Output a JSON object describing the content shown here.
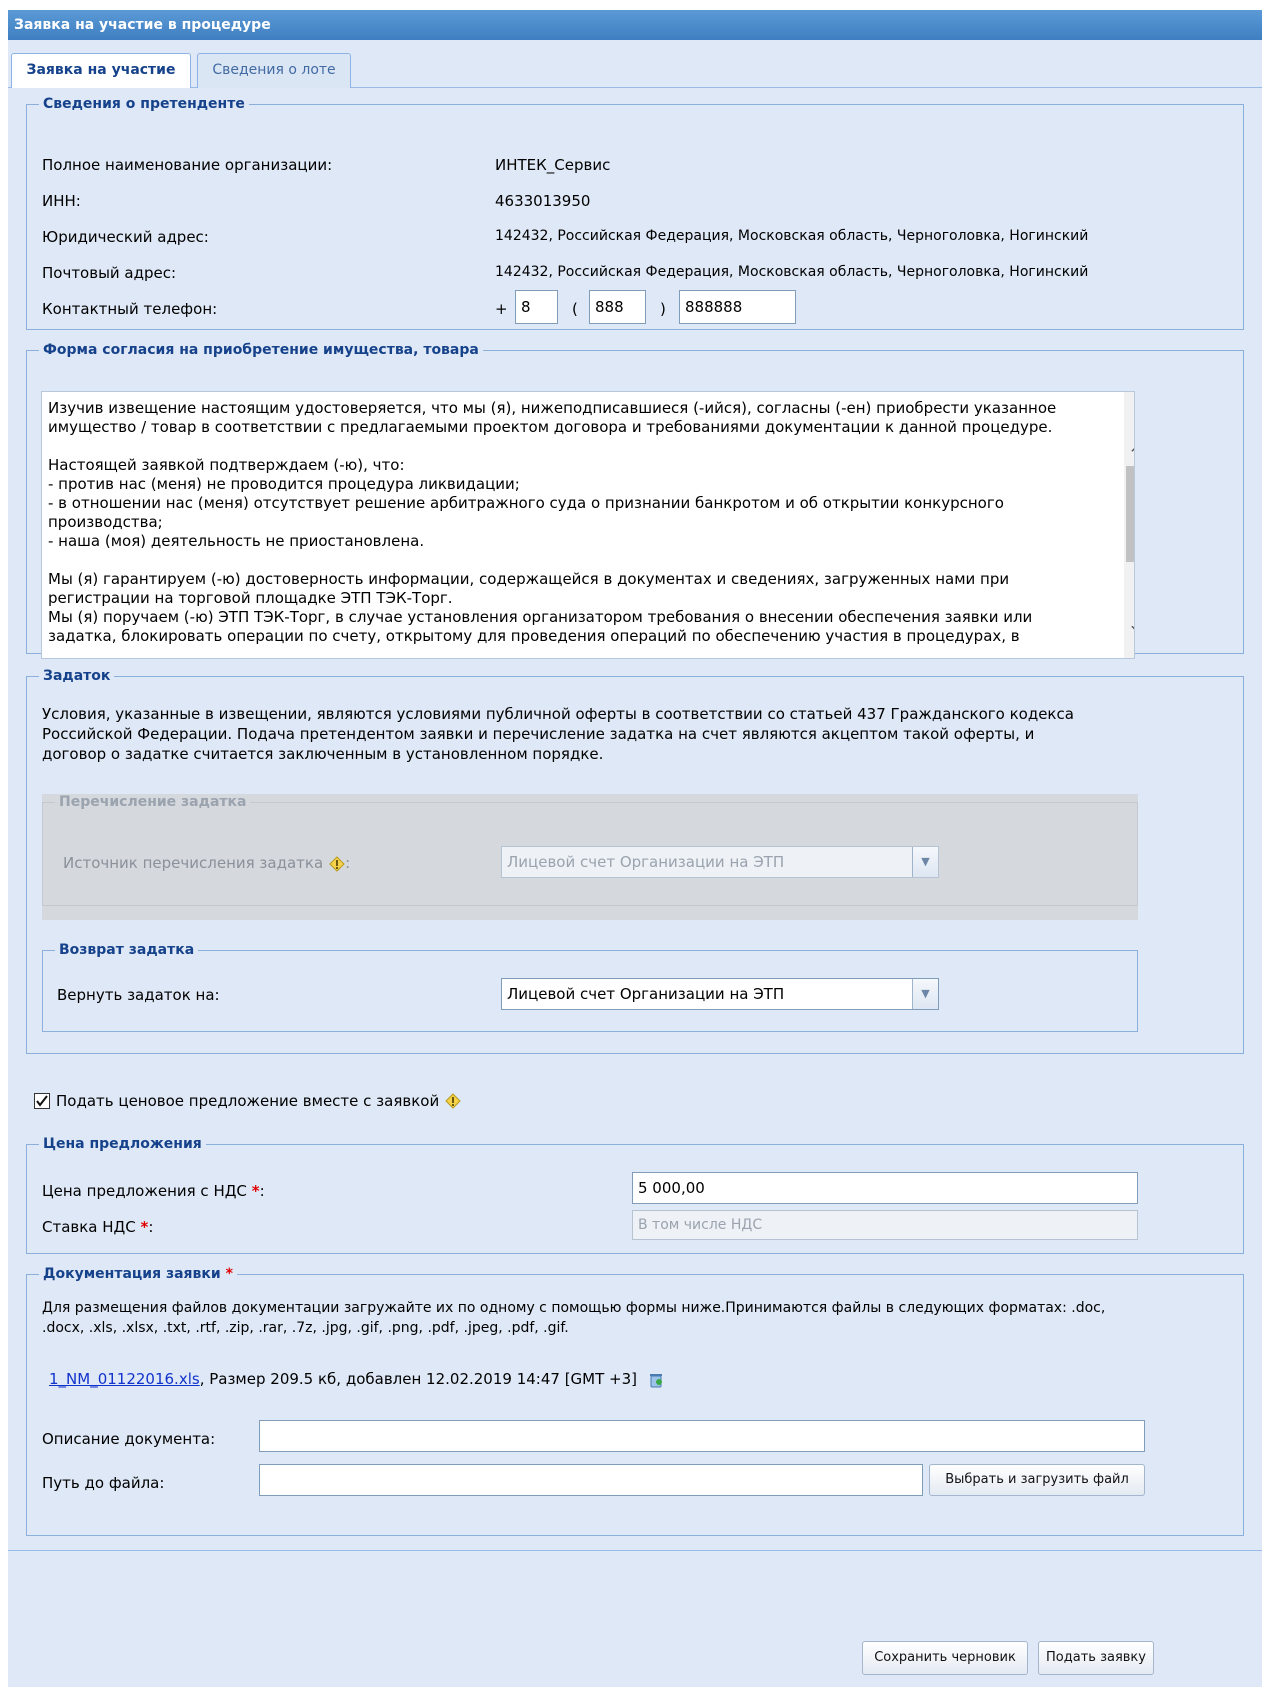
{
  "window": {
    "title": "Заявка на участие в процедуре"
  },
  "tabs": [
    {
      "label": "Заявка на участие",
      "active": true
    },
    {
      "label": "Сведения о лоте",
      "active": false
    }
  ],
  "applicant": {
    "legend": "Сведения о претенденте",
    "org_label": "Полное наименование организации:",
    "org_value": "ИНТЕК_Сервис",
    "inn_label": "ИНН:",
    "inn_value": "4633013950",
    "legal_address_label": "Юридический адрес:",
    "legal_address_value": "142432, Российская Федерация, Московская область, Черноголовка, Ногинский",
    "postal_address_label": "Почтовый адрес:",
    "postal_address_value": "142432, Российская Федерация, Московская область, Черноголовка, Ногинский",
    "phone_label": "Контактный телефон:",
    "phone_plus": "+",
    "phone_open": "(",
    "phone_close": ")",
    "phone_country": "8",
    "phone_code": "888",
    "phone_number": "888888"
  },
  "agreement": {
    "legend": "Форма согласия на приобретение имущества, товара",
    "p1": "Изучив извещение настоящим удостоверяется, что мы (я), нижеподписавшиеся (-ийся), согласны (-ен) приобрести указанное имущество / товар в соответствии с предлагаемыми проектом договора и требованиями документации к данной процедуре.",
    "p2_lines": [
      "Настоящей заявкой подтверждаем (-ю), что:",
      "- против нас (меня) не проводится процедура ликвидации;",
      "- в отношении нас (меня) отсутствует решение арбитражного суда о признании банкротом и об открытии конкурсного производства;",
      "- наша (моя) деятельность не приостановлена."
    ],
    "p3_lines": [
      "Мы (я) гарантируем (-ю) достоверность информации, содержащейся в документах и сведениях, загруженных нами при регистрации на торговой площадке ЭТП ТЭК-Торг.",
      "Мы (я) поручаем (-ю) ЭТП ТЭК-Торг, в случае установления организатором требования о внесении обеспечения заявки или задатка, блокировать операции по счету, открытому для проведения операций по обеспечению участия в процедурах, в"
    ]
  },
  "deposit": {
    "legend": "Задаток",
    "text": "Условия, указанные в извещении, являются условиями публичной оферты в соответствии со статьей 437 Гражданского кодекса Российской Федерации. Подача претендентом заявки и перечисление задатка на счет являются акцептом такой оферты, и договор о задатке считается заключенным в установленном порядке.",
    "transfer_legend": "Перечисление задатка",
    "transfer_source_label": "Источник перечисления задатка",
    "transfer_source_value": "Лицевой счет Организации на ЭТП",
    "return_legend": "Возврат задатка",
    "return_label": "Вернуть задаток на:",
    "return_value": "Лицевой счет Организации на ЭТП"
  },
  "price_offer_checkbox": {
    "label": "Подать ценовое предложение вместе с заявкой",
    "checked": true
  },
  "price": {
    "legend": "Цена предложения",
    "price_label": "Цена предложения с НДС",
    "price_value": "5 000,00",
    "vat_label": "Ставка НДС",
    "vat_placeholder": "В том числе НДС",
    "required_mark": "*",
    "colon": ":"
  },
  "docs": {
    "legend": "Документация заявки",
    "required_mark": "*",
    "text": "Для размещения файлов документации загружайте их по одному с помощью формы ниже.Принимаются файлы в следующих форматах: .doc, .docx, .xls, .xlsx, .txt, .rtf, .zip, .rar, .7z, .jpg, .gif, .png, .pdf, .jpeg, .pdf, .gif.",
    "file_name": "1_NM_01122016.xls",
    "file_info": ", Размер 209.5 кб, добавлен 12.02.2019 14:47 [GMT +3]",
    "description_label": "Описание документа:",
    "path_label": "Путь до файла:",
    "upload_button": "Выбрать и загрузить файл"
  },
  "footer": {
    "save_draft": "Сохранить черновик",
    "submit": "Подать заявку"
  },
  "colors": {
    "title_bar": "#3f7fc1",
    "panel_bg": "#dfe8f6",
    "legend_text": "#15428b",
    "required": "#e00000"
  }
}
